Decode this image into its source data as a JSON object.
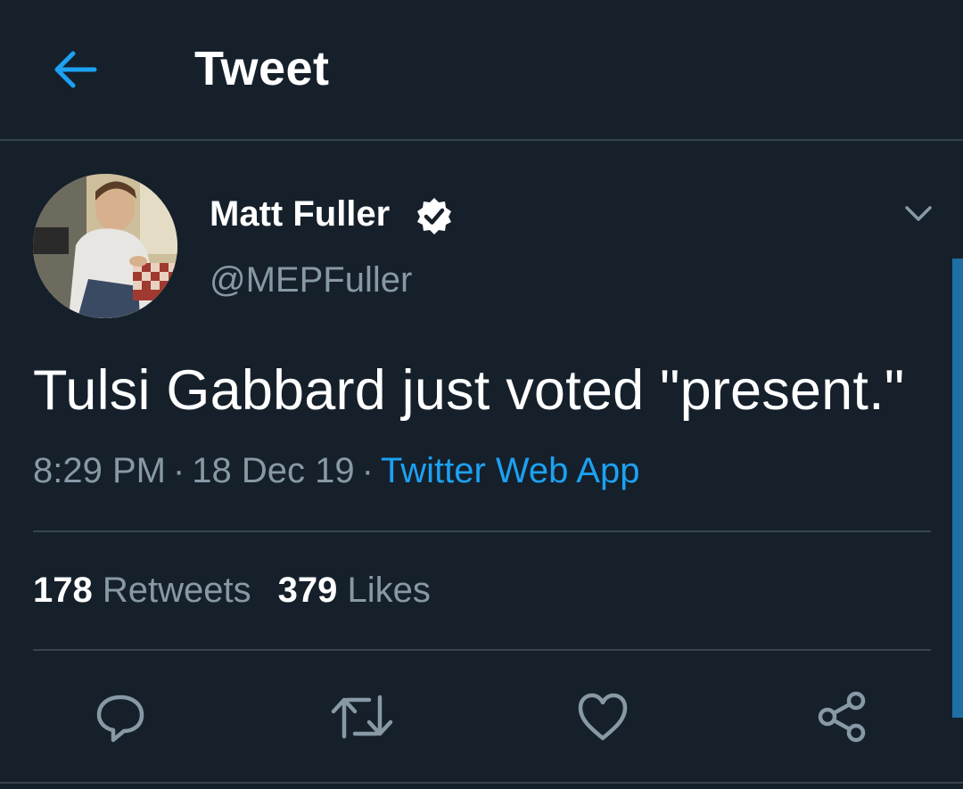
{
  "header": {
    "title": "Tweet",
    "back_icon": "arrow-left-icon"
  },
  "author": {
    "name": "Matt Fuller",
    "handle": "@MEPFuller",
    "verified": true,
    "avatar": "profile-photo"
  },
  "tweet": {
    "text": "Tulsi Gabbard just voted \"present.\"",
    "time": "8:29 PM",
    "separator": "·",
    "date": "18 Dec 19",
    "source": "Twitter Web App"
  },
  "stats": {
    "retweets_count": "178",
    "retweets_label": "Retweets",
    "likes_count": "379",
    "likes_label": "Likes"
  },
  "actions": [
    "reply-icon",
    "retweet-icon",
    "like-icon",
    "share-icon"
  ],
  "colors": {
    "background": "#15202b",
    "accent": "#1da1f2",
    "secondary_text": "#8899a6",
    "divider": "#38444d"
  }
}
